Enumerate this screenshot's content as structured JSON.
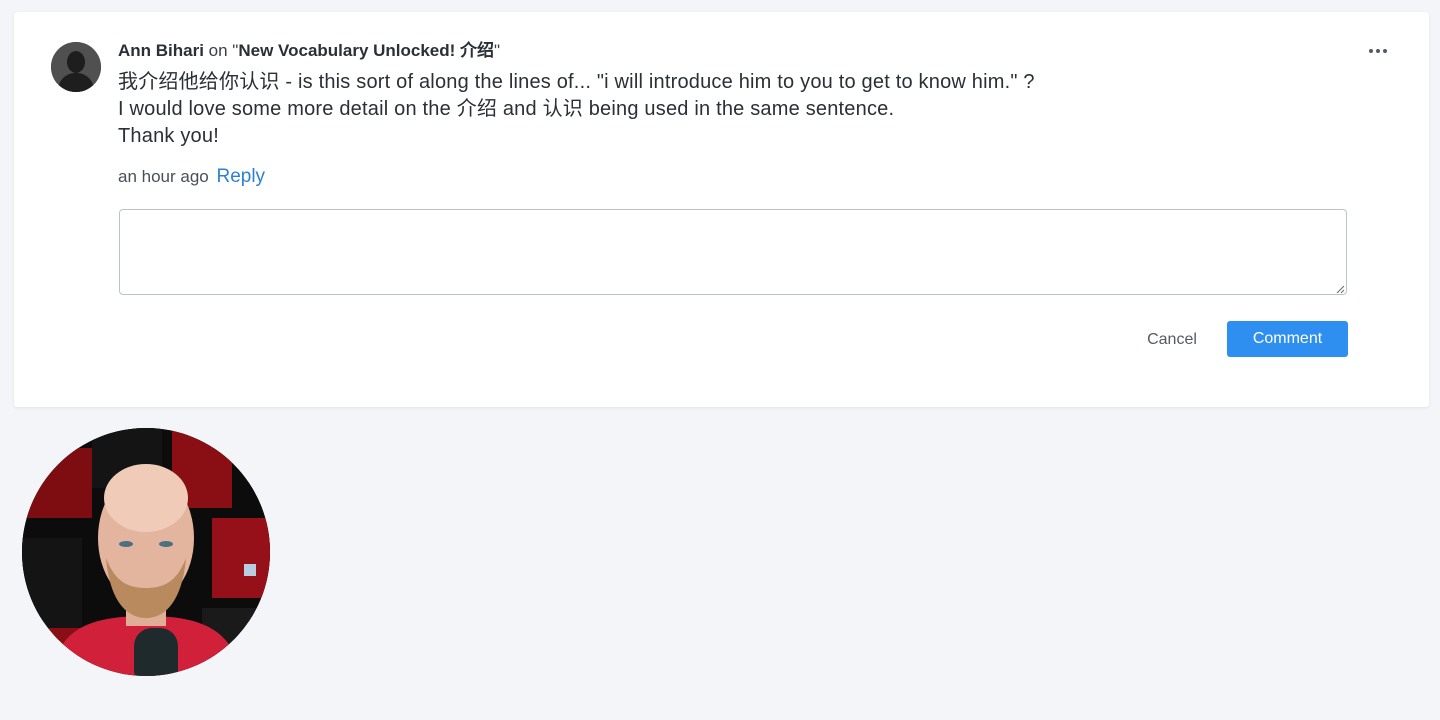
{
  "comment": {
    "author": "Ann Bihari",
    "on_text": " on \"",
    "post_title": "New Vocabulary Unlocked! 介绍",
    "close_quote": "\"",
    "body_lines": [
      "我介绍他给你认识 - is this sort of along the lines of... \"i will introduce him to you to get to know him.\" ?",
      "I would love some more detail on the 介绍 and 认识 being used in the same sentence.",
      "Thank you!"
    ],
    "timestamp": "an hour ago",
    "reply_label": "Reply",
    "more_icon": "ellipsis-horizontal-icon",
    "avatar_icon": "user-silhouette-icon"
  },
  "reply_form": {
    "value": "",
    "placeholder": "",
    "cancel_label": "Cancel",
    "submit_label": "Comment"
  },
  "colors": {
    "page_background": "#f3f5f8",
    "card_background": "#ffffff",
    "link": "#2d7fd7",
    "primary_button": "#2e8ff0",
    "text": "#2b2f36"
  }
}
